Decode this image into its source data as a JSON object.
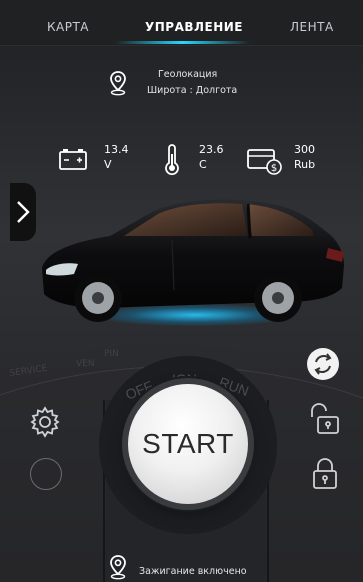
{
  "tabs": [
    {
      "label": "КАРТА",
      "active": false
    },
    {
      "label": "УПРАВЛЕНИЕ",
      "active": true
    },
    {
      "label": "ЛЕНТА",
      "active": false
    }
  ],
  "geo": {
    "title": "Геолокация",
    "subtitle": "Широта : Долгота",
    "icon": "location-pin-icon"
  },
  "stats": [
    {
      "icon": "battery-icon",
      "value": "13.4",
      "unit": "V"
    },
    {
      "icon": "thermometer-icon",
      "value": "23.6",
      "unit": "C"
    },
    {
      "icon": "wallet-icon",
      "value": "300",
      "unit": "Rub"
    }
  ],
  "dial": {
    "labels": [
      "OFF",
      "IGN",
      "RUN"
    ],
    "left_labels": [
      "SERVICE",
      "VEN",
      "PIN"
    ]
  },
  "start_button": {
    "label": "START"
  },
  "status": {
    "text": "Зажигание включено",
    "icon": "location-pin-icon"
  },
  "colors": {
    "accent": "#28d8ff",
    "background": "#26282b",
    "button": "#efefef"
  }
}
